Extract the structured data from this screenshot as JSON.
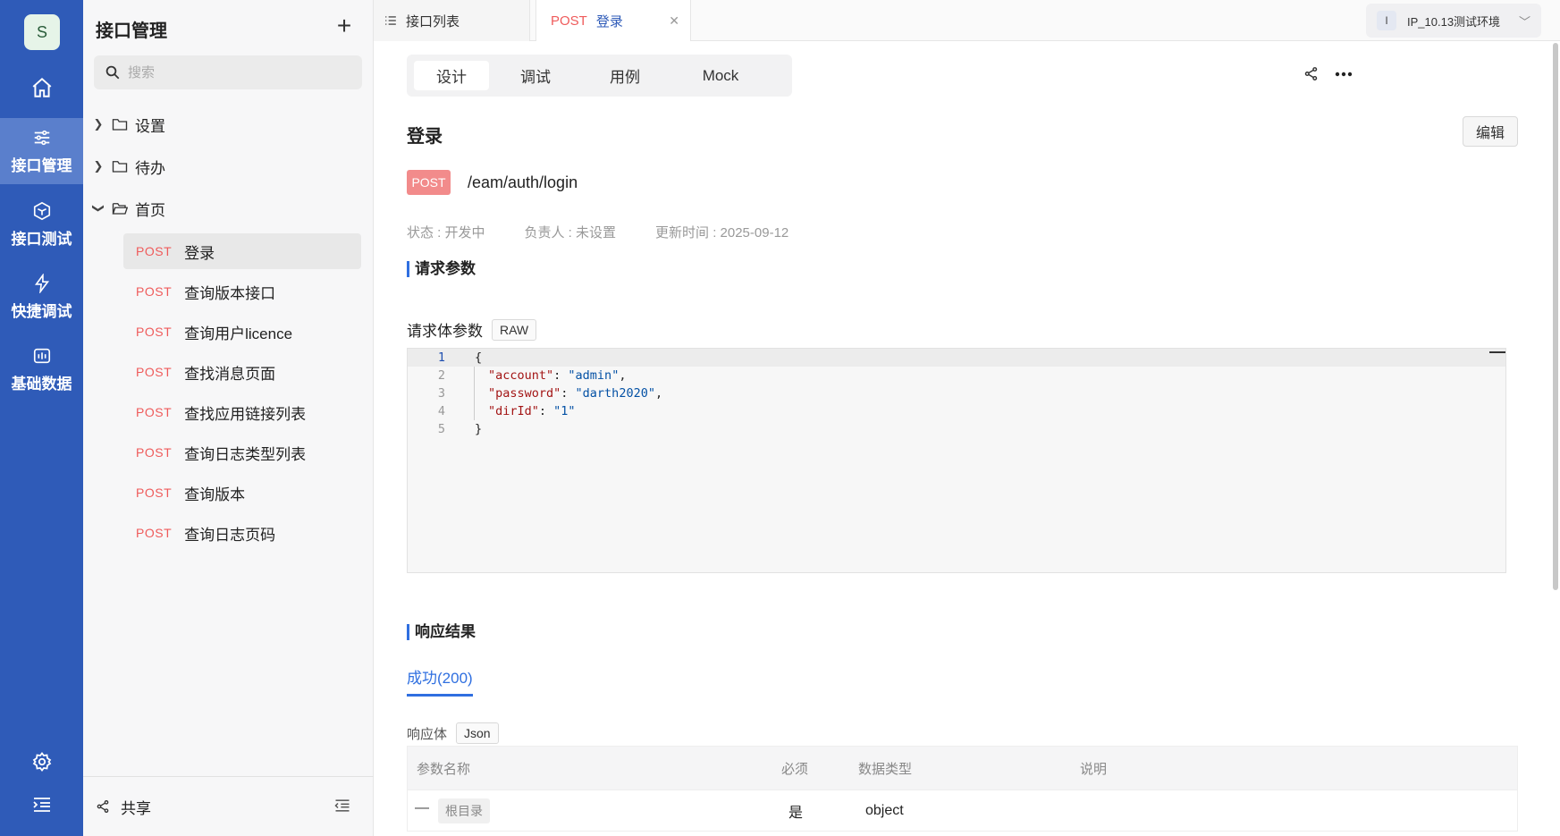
{
  "nav": {
    "avatar": "S",
    "items": [
      {
        "label": "接口管理",
        "icon": "sliders-icon"
      },
      {
        "label": "接口测试",
        "icon": "cube-icon"
      },
      {
        "label": "快捷调试",
        "icon": "lightning-icon"
      },
      {
        "label": "基础数据",
        "icon": "chart-box-icon"
      }
    ]
  },
  "tree": {
    "title": "接口管理",
    "search_placeholder": "搜索",
    "folders": [
      {
        "name": "设置",
        "expanded": false
      },
      {
        "name": "待办",
        "expanded": false
      },
      {
        "name": "首页",
        "expanded": true
      }
    ],
    "items": [
      {
        "method": "POST",
        "name": "登录"
      },
      {
        "method": "POST",
        "name": "查询版本接口"
      },
      {
        "method": "POST",
        "name": "查询用户licence"
      },
      {
        "method": "POST",
        "name": "查找消息页面"
      },
      {
        "method": "POST",
        "name": "查找应用链接列表"
      },
      {
        "method": "POST",
        "name": "查询日志类型列表"
      },
      {
        "method": "POST",
        "name": "查询版本"
      },
      {
        "method": "POST",
        "name": "查询日志页码"
      }
    ],
    "share_label": "共享"
  },
  "tabs": {
    "list_label": "接口列表",
    "active_method": "POST",
    "active_name": "登录",
    "close": "✕"
  },
  "env": {
    "badge": "I",
    "label": "IP_10.13测试环境"
  },
  "main": {
    "subtabs": [
      "设计",
      "调试",
      "用例",
      "Mock"
    ],
    "title": "登录",
    "edit_label": "编辑",
    "method": "POST",
    "path": "/eam/auth/login",
    "status": "状态 : 开发中",
    "owner": "负责人 : 未设置",
    "updated": "更新时间 : 2025-09-12",
    "request_title": "请求参数",
    "body_label": "请求体参数",
    "body_type": "RAW",
    "code_line_numbers": [
      "1",
      "2",
      "3",
      "4",
      "5"
    ],
    "code": {
      "open": "{",
      "k1": "\"account\"",
      "v1": "\"admin\"",
      "k2": "\"password\"",
      "v2": "\"darth2020\"",
      "k3": "\"dirId\"",
      "v3": "\"1\"",
      "close": "}"
    },
    "response_title": "响应结果",
    "response_tab": "成功(200)",
    "response_body_label": "响应体",
    "response_body_type": "Json",
    "table_headers": [
      "参数名称",
      "必须",
      "数据类型",
      "说明"
    ],
    "table_row": {
      "name": "根目录",
      "required": "是",
      "type": "object",
      "desc": ""
    }
  },
  "colors": {
    "nav_bg": "#2f5bb8",
    "method_red": "#ef5b5b",
    "accent_blue": "#2f6fe0"
  }
}
